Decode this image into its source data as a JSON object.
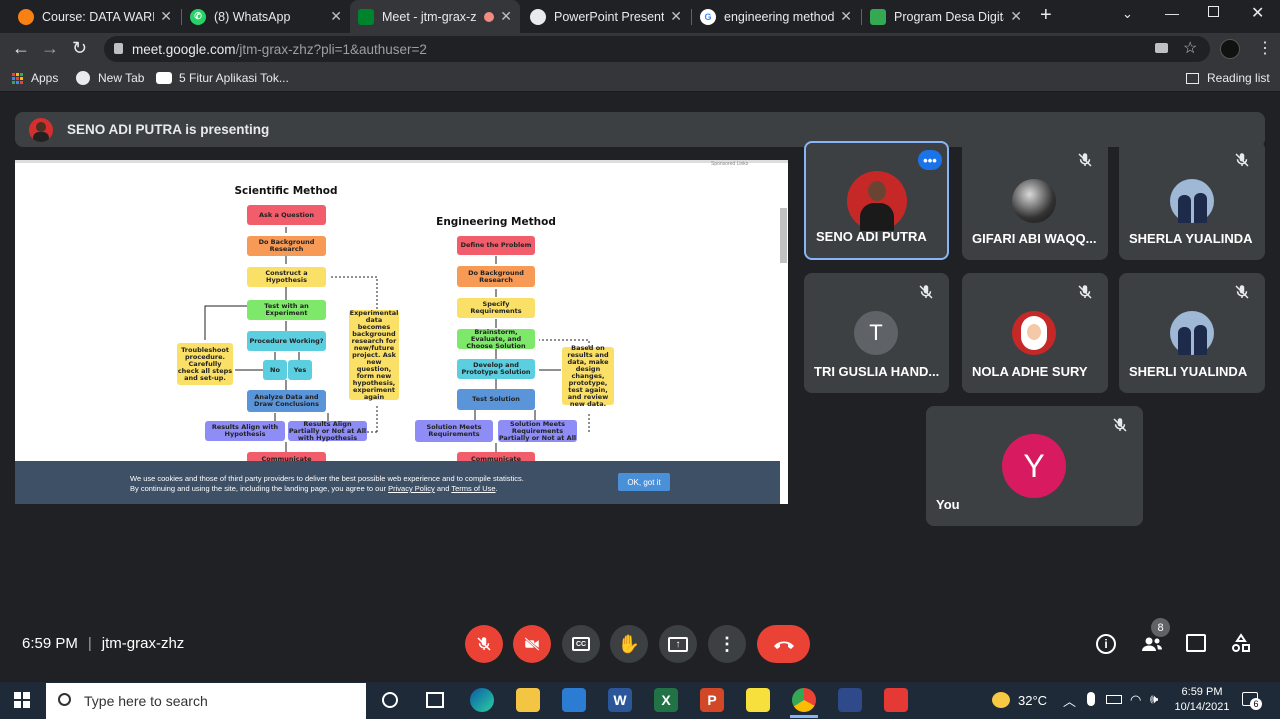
{
  "tabs": [
    {
      "title": "Course: DATA WAREH",
      "icon": "moodle-icon",
      "color": "#f98012",
      "active": false
    },
    {
      "title": "(8) WhatsApp",
      "icon": "whatsapp-icon",
      "color": "#25d366",
      "active": false
    },
    {
      "title": "Meet - jtm-grax-z",
      "icon": "meet-icon",
      "color": "#00832d",
      "active": true
    },
    {
      "title": "PowerPoint Presentati",
      "icon": "globe-icon",
      "color": "#9aa0a6",
      "active": false
    },
    {
      "title": "engineering method v",
      "icon": "google-icon",
      "color": "#4285f4",
      "active": false
    },
    {
      "title": "Program Desa Digital",
      "icon": "doc-icon",
      "color": "#34a853",
      "active": false
    }
  ],
  "address": {
    "host": "meet.google.com",
    "path": "/jtm-grax-zhz?pli=1&authuser=2"
  },
  "bookmarks": [
    {
      "label": "Apps"
    },
    {
      "label": "New Tab"
    },
    {
      "label": "5 Fitur Aplikasi Tok..."
    }
  ],
  "reading_list": "Reading list",
  "banner": {
    "text": "SENO ADI PUTRA is presenting"
  },
  "slide": {
    "sponsored": "Sponsored Links",
    "sci_title": "Scientific Method",
    "eng_title": "Engineering Method",
    "sci_steps": [
      "Ask a Question",
      "Do Background Research",
      "Construct a Hypothesis",
      "Test with an Experiment",
      "Procedure Working?",
      "No",
      "Yes",
      "Analyze Data and Draw Conclusions",
      "Results Align with Hypothesis",
      "Results Align Partially or Not at All with Hypothesis",
      "Communicate"
    ],
    "sci_side": "Troubleshoot procedure. Carefully check all steps and set-up.",
    "sci_note": "Experimental data becomes background research for new/future project. Ask new question, form new hypothesis, experiment again",
    "eng_steps": [
      "Define the Problem",
      "Do Background Research",
      "Specify Requirements",
      "Brainstorm, Evaluate, and Choose Solution",
      "Develop and Prototype Solution",
      "Test Solution",
      "Solution Meets Requirements",
      "Solution Meets Requirements Partially or Not at All",
      "Communicate"
    ],
    "eng_note": "Based on results and data, make design changes, prototype, test again, and review new data.",
    "cookie_line1": "We use cookies and those of third party providers to deliver the best possible web experience and to compile statistics.",
    "cookie_line2": "By continuing and using the site, including the landing page, you agree to our",
    "privacy": "Privacy Policy",
    "and": "and",
    "terms": "Terms of Use",
    "ok": "OK, got it"
  },
  "participants": [
    {
      "name": "SENO ADI PUTRA",
      "muted": false,
      "highlight": true
    },
    {
      "name": "GIFARI ABI WAQQ...",
      "muted": true
    },
    {
      "name": "SHERLA YUALINDA",
      "muted": true
    },
    {
      "name": "TRI GUSLIA HAND...",
      "muted": true,
      "initial": "T"
    },
    {
      "name": "NOLA ADHE SURY",
      "muted": true
    },
    {
      "name": "SHERLI YUALINDA",
      "muted": true
    },
    {
      "name": "You",
      "muted": true,
      "initial": "Y"
    }
  ],
  "meeting": {
    "time": "6:59 PM",
    "code": "jtm-grax-zhz",
    "people_count": "8"
  },
  "taskbar": {
    "search_placeholder": "Type here to search",
    "temp": "32°C",
    "time": "6:59 PM",
    "date": "10/14/2021",
    "notif": "6"
  }
}
